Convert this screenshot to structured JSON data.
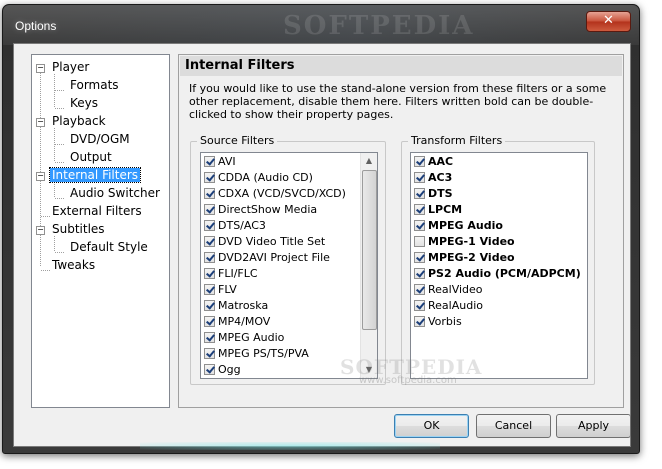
{
  "window": {
    "title": "Options",
    "close_glyph": "✕",
    "watermark": "SOFTPEDIA"
  },
  "tree": {
    "items": [
      {
        "label": "Player",
        "expander": "−"
      },
      {
        "label": "Formats"
      },
      {
        "label": "Keys"
      },
      {
        "label": "Playback",
        "expander": "−"
      },
      {
        "label": "DVD/OGM"
      },
      {
        "label": "Output"
      },
      {
        "label": "Internal Filters",
        "expander": "−",
        "selected": true
      },
      {
        "label": "Audio Switcher"
      },
      {
        "label": "External Filters"
      },
      {
        "label": "Subtitles",
        "expander": "−"
      },
      {
        "label": "Default Style"
      },
      {
        "label": "Tweaks"
      }
    ]
  },
  "panel": {
    "heading": "Internal Filters",
    "description": "If you would like to use the stand-alone version from these filters or a some other replacement, disable them here. Filters written bold can be double-clicked to show their property pages.",
    "source_filters": {
      "title": "Source Filters",
      "items": [
        {
          "label": "AVI",
          "checked": true
        },
        {
          "label": "CDDA (Audio CD)",
          "checked": true
        },
        {
          "label": "CDXA (VCD/SVCD/XCD)",
          "checked": true
        },
        {
          "label": "DirectShow Media",
          "checked": true
        },
        {
          "label": "DTS/AC3",
          "checked": true
        },
        {
          "label": "DVD Video Title Set",
          "checked": true
        },
        {
          "label": "DVD2AVI Project File",
          "checked": true
        },
        {
          "label": "FLI/FLC",
          "checked": true
        },
        {
          "label": "FLV",
          "checked": true
        },
        {
          "label": "Matroska",
          "checked": true
        },
        {
          "label": "MP4/MOV",
          "checked": true
        },
        {
          "label": "MPEG Audio",
          "checked": true
        },
        {
          "label": "MPEG PS/TS/PVA",
          "checked": true
        },
        {
          "label": "Ogg",
          "checked": true
        }
      ],
      "scroll_up": "▲",
      "scroll_down": "▼"
    },
    "transform_filters": {
      "title": "Transform Filters",
      "items": [
        {
          "label": "AAC",
          "checked": true,
          "bold": true
        },
        {
          "label": "AC3",
          "checked": true,
          "bold": true
        },
        {
          "label": "DTS",
          "checked": true,
          "bold": true
        },
        {
          "label": "LPCM",
          "checked": true,
          "bold": true
        },
        {
          "label": "MPEG Audio",
          "checked": true,
          "bold": true
        },
        {
          "label": "MPEG-1 Video",
          "checked": false,
          "bold": true
        },
        {
          "label": "MPEG-2 Video",
          "checked": true,
          "bold": true
        },
        {
          "label": "PS2 Audio (PCM/ADPCM)",
          "checked": true,
          "bold": true
        },
        {
          "label": "RealVideo",
          "checked": true,
          "bold": false
        },
        {
          "label": "RealAudio",
          "checked": true,
          "bold": false
        },
        {
          "label": "Vorbis",
          "checked": true,
          "bold": false
        }
      ]
    },
    "watermark_mid": "SOFTPEDIA",
    "watermark_small": "www.softpedia.com"
  },
  "buttons": {
    "ok": "OK",
    "cancel": "Cancel",
    "apply": "Apply"
  }
}
